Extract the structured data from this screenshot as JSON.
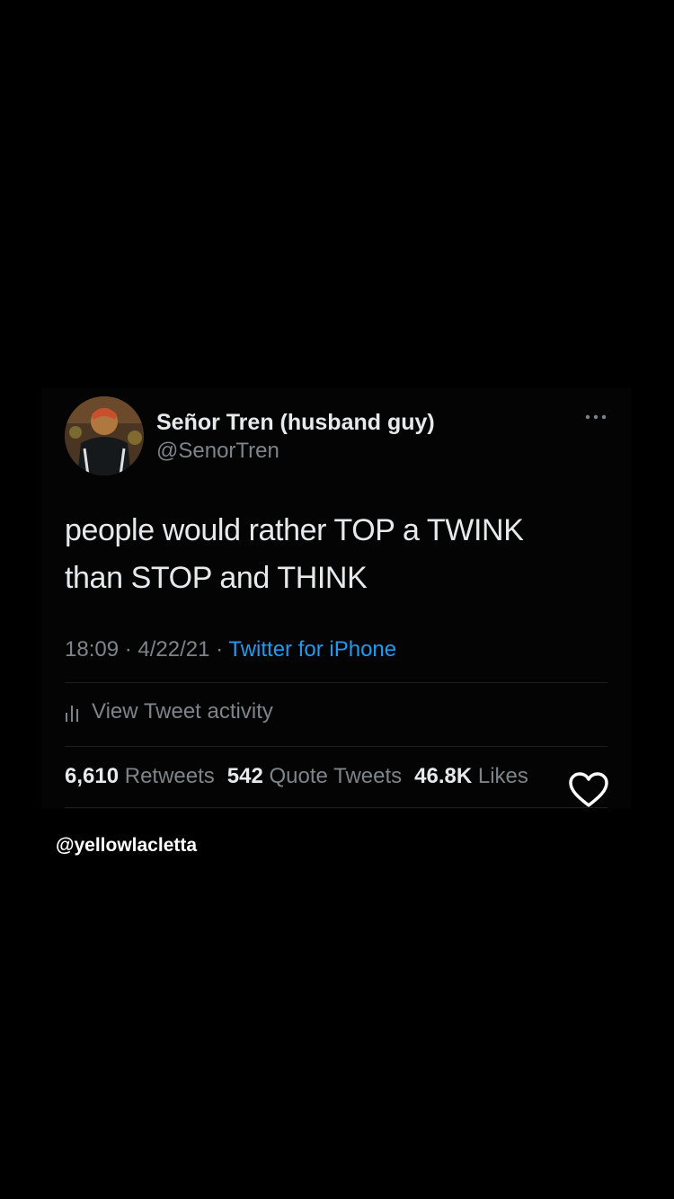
{
  "tweet": {
    "display_name": "Señor Tren (husband guy)",
    "handle": "@SenorTren",
    "text_line1": "people would rather TOP a TWINK",
    "text_line2": "than STOP and THINK",
    "time": "18:09",
    "date": "4/22/21",
    "separator": " · ",
    "source": "Twitter for iPhone",
    "activity_label": "View Tweet activity",
    "stats": {
      "retweets_count": "6,610",
      "retweets_label": "Retweets",
      "quotes_count": "542",
      "quotes_label": "Quote Tweets",
      "likes_count": "46.8K",
      "likes_label": "Likes"
    }
  },
  "overlay": {
    "watermark": "@yellowlacletta",
    "heart_icon": "heart-outline-icon"
  },
  "colors": {
    "background": "#000000",
    "primary_text": "#e7e9ea",
    "secondary_text": "#7d8489",
    "link": "#1d9bf0"
  },
  "icons": {
    "more": "more-horizontal-icon",
    "activity": "bar-chart-icon",
    "avatar": "avatar"
  }
}
